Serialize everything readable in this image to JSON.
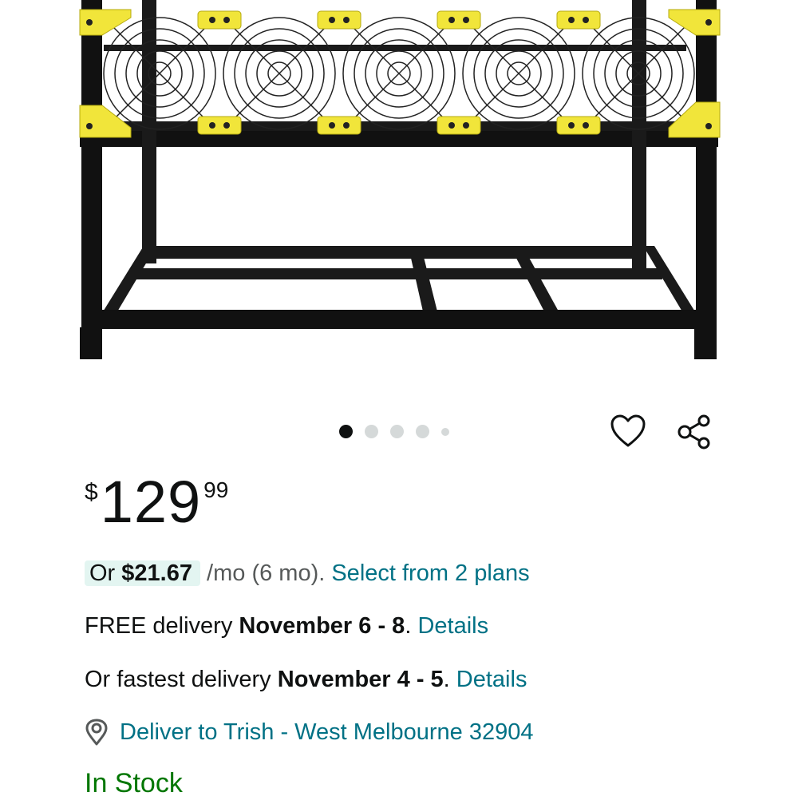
{
  "price": {
    "symbol": "$",
    "whole": "129",
    "fraction": "99"
  },
  "installment": {
    "prefix": "Or ",
    "amount": "$21.67",
    "terms": " /mo (6 mo). ",
    "link": "Select from 2 plans"
  },
  "delivery_free": {
    "prefix": "FREE delivery ",
    "date": "November 6 - 8",
    "dot": ". ",
    "link": "Details"
  },
  "delivery_fast": {
    "prefix": "Or fastest delivery ",
    "date": "November 4 - 5",
    "dot": ". ",
    "link": "Details"
  },
  "deliver_to": {
    "text": "Deliver to Trish - West Melbourne 32904",
    "icon": "location-pin-icon"
  },
  "stock": "In Stock",
  "carousel": {
    "count": 5,
    "active": 1
  },
  "icons": {
    "wishlist": "heart-icon",
    "share": "share-icon"
  },
  "colors": {
    "link": "#007185",
    "in_stock": "#007600",
    "pill_bg": "#e3f5f1",
    "accent_yellow": "#f1e53a"
  }
}
